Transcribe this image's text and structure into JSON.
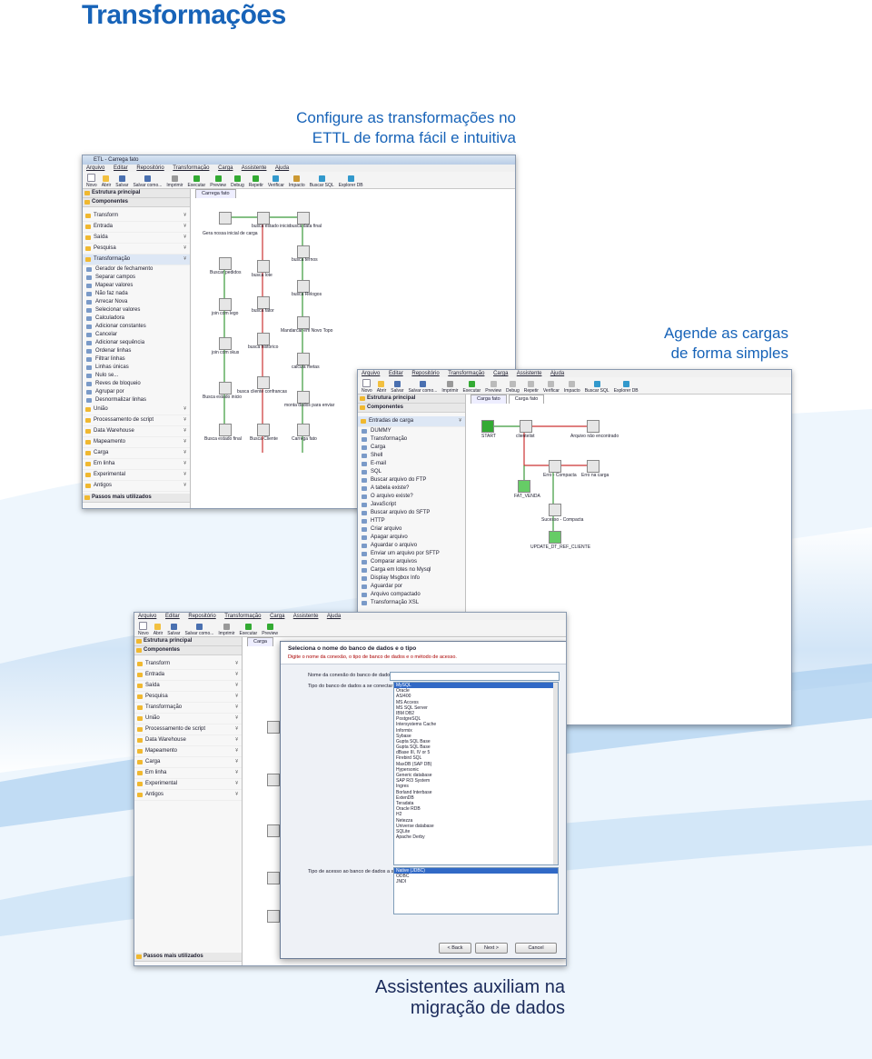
{
  "page": {
    "title": "Transformações",
    "caption_top_lines": [
      "Configure as transformações no",
      "ETTL de forma fácil e intuitiva"
    ],
    "caption_right_lines": [
      "Agende as cargas",
      "de forma simples"
    ],
    "caption_bottom_lines": [
      "Assistentes auxiliam na",
      "migração de dados"
    ]
  },
  "colors": {
    "brand_blue": "#1763b8",
    "caption_dark": "#1a2a5a"
  },
  "window1": {
    "title": "ETL - Carrega fato",
    "menu": [
      "Arquivo",
      "Editar",
      "Repositório",
      "Transformação",
      "Carga",
      "Assistente",
      "Ajuda"
    ],
    "toolbar": [
      "Novo",
      "Abrir",
      "Salvar",
      "Salvar como...",
      "Imprimir",
      "Executar",
      "Preview",
      "Debug",
      "Repetir",
      "Verificar",
      "Impacto",
      "Buscar SQL",
      "Explorer DB"
    ],
    "panel_main": "Estrutura principal",
    "panel_comp": "Componentes",
    "categories_top": [
      "Transform",
      "Entrada",
      "Saída",
      "Pesquisa",
      "Transformação"
    ],
    "subitems": [
      "Gerador de fechamento",
      "Separar campos",
      "Mapear valores",
      "Não faz nada",
      "Arrecar Nova",
      "Selecionar valores",
      "Calculadora",
      "Adicionar constantes",
      "Cancelar",
      "Adicionar sequência",
      "Ordenar linhas",
      "Filtrar linhas",
      "Linhas únicas",
      "Nulo se...",
      "Reves de bloqueio",
      "Agrupar por",
      "Desnormalizar linhas"
    ],
    "categories_bottom": [
      "União",
      "Processamento de script",
      "Data Warehouse",
      "Mapeamento",
      "Carga",
      "Em linha",
      "Experimental",
      "Antigos"
    ],
    "footer": "Passos mais utilizados",
    "tab": "Carrega fato",
    "nodes": [
      "Gera nossa inicial de carga",
      "busca estado inicio",
      "busca data final",
      "Buscar pedidos",
      "busca lote",
      "busca ternos",
      "busca Relogos",
      "join com lego",
      "busca fator",
      "Mandarcar em Novo Topo",
      "join com skus",
      "busca historico",
      "calcula metas",
      "Busca estado inicio",
      "busca cliente confrancas",
      "monta dados para enviar",
      "Busca estado final",
      "Busca Cliente",
      "Carrega fato"
    ]
  },
  "window2": {
    "menu": [
      "Arquivo",
      "Editar",
      "Repositório",
      "Transformação",
      "Carga",
      "Assistente",
      "Ajuda"
    ],
    "toolbar": [
      "Novo",
      "Abrir",
      "Salvar",
      "Salvar como...",
      "Imprimir",
      "Executar",
      "Preview",
      "Debug",
      "Repetir",
      "Verificar",
      "Impacto",
      "Buscar SQL",
      "Explorer DB"
    ],
    "panel_main": "Estrutura principal",
    "panel_comp": "Componentes",
    "group": "Entradas de carga",
    "items": [
      "DUMMY",
      "Transformação",
      "Carga",
      "Shell",
      "E-mail",
      "SQL",
      "Buscar arquivo do FTP",
      "A tabela existe?",
      "O arquivo existe?",
      "JavaScript",
      "Buscar arquivo do SFTP",
      "HTTP",
      "Criar arquivo",
      "Apagar arquivo",
      "Aguardar o arquivo",
      "Enviar um arquivo por SFTP",
      "Comparar arquivos",
      "Carga em lotes no Mysql",
      "Display Msgbox Info",
      "Aguardar por",
      "Arquivo compactado",
      "Transformação XSL"
    ],
    "tabs": [
      "Carga fato",
      "Carga fato"
    ],
    "nodes": [
      "START",
      "clientelist",
      "Arquivo não encontrado",
      "Erro - Compacta",
      "Erro na carga",
      "FAT_VENDA",
      "Sucesso - Compacta",
      "UPDATE_DT_REF_CLIENTE"
    ]
  },
  "window3": {
    "menu": [
      "Arquivo",
      "Editar",
      "Repositório",
      "Transformação",
      "Carga",
      "Assistente",
      "Ajuda"
    ],
    "toolbar": [
      "Novo",
      "Abrir",
      "Salvar",
      "Salvar como...",
      "Imprimir",
      "Executar",
      "Preview"
    ],
    "panel_main": "Estrutura principal",
    "panel_comp": "Componentes",
    "categories": [
      "Transform",
      "Entrada",
      "Saída",
      "Pesquisa",
      "Transformação",
      "União",
      "Processamento de script",
      "Data Warehouse",
      "Mapeamento",
      "Carga",
      "Em linha",
      "Experimental",
      "Antigos"
    ],
    "footer": "Passos mais utilizados",
    "tab": "Carga",
    "dialog": {
      "title": "Seleciona o nome do banco de dados e o tipo",
      "subtitle": "Digite o nome da conexão, o tipo de banco de dados e o método de acesso.",
      "label_name": "Nome da conexão do banco de dados",
      "label_type": "Tipo do banco de dados a se conectar",
      "label_access": "Tipo de acesso ao banco de dados a se conectar",
      "db_types": [
        "MySQL",
        "Oracle",
        "AS/400",
        "MS Access",
        "MS SQL Server",
        "IBM DB2",
        "PostgreSQL",
        "Intersystems Cache",
        "Informix",
        "Sybase",
        "Gupta SQL Base",
        "Gupta SQL Base",
        "dBase III, IV or 5",
        "Firebird SQL",
        "MaxDB (SAP DB)",
        "Hypersonic",
        "Generic database",
        "SAP R/3 System",
        "Ingres",
        "Borland Interbase",
        "ExtenDB",
        "Teradata",
        "Oracle RDB",
        "H2",
        "Netezza",
        "Universe database",
        "SQLite",
        "Apache Derby"
      ],
      "access_types": [
        "Native (JDBC)",
        "ODBC",
        "JNDI"
      ],
      "btn_back": "< Back",
      "btn_next": "Next >",
      "btn_cancel": "Cancel"
    }
  }
}
